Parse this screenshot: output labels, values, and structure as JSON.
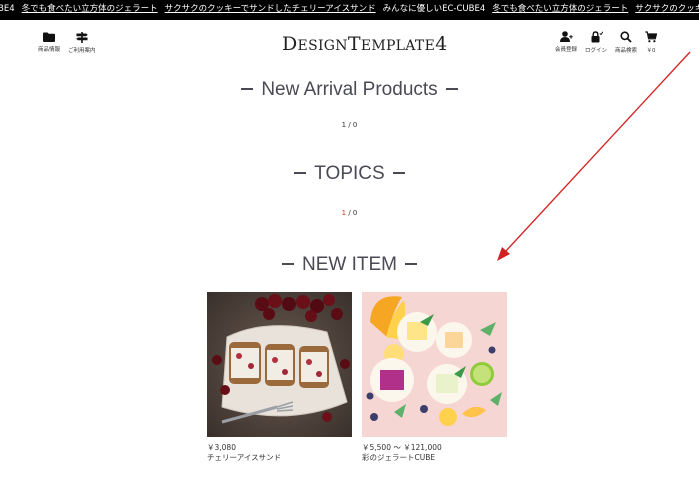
{
  "ticker": {
    "items": [
      {
        "text": "BE4",
        "link": false
      },
      {
        "text": "冬でも食べたい立方体のジェラート",
        "link": true
      },
      {
        "text": "サクサクのクッキーでサンドしたチェリーアイスサンド",
        "link": true
      },
      {
        "text": "みんなに優しいEC-CUBE4",
        "link": false
      },
      {
        "text": "冬でも食べたい立方体のジェラート",
        "link": true
      },
      {
        "text": "サクサクのクッキーでサンドしたチェリーアイスサ",
        "link": true
      }
    ]
  },
  "header": {
    "left": [
      {
        "label": "商品情報",
        "icon": "folder-icon"
      },
      {
        "label": "ご利用案内",
        "icon": "signpost-icon"
      }
    ],
    "logo": {
      "d": "D",
      "esign": "ESIGN",
      "t": "T",
      "emplate": "EMPLATE",
      "num": "4"
    },
    "right": [
      {
        "label": "会員登録",
        "icon": "user-add-icon"
      },
      {
        "label": "ログイン",
        "icon": "lock-icon"
      },
      {
        "label": "商品検索",
        "icon": "search-icon"
      },
      {
        "label": "￥0",
        "icon": "cart-icon"
      }
    ]
  },
  "sections": {
    "new_arrival": {
      "title": "New Arrival Products",
      "pager_cur": "1",
      "pager_rest": " / 0"
    },
    "topics": {
      "title": "TOPICS",
      "pager_cur": "1",
      "pager_rest": " / 0"
    },
    "new_item": {
      "title": "NEW ITEM"
    }
  },
  "products": [
    {
      "price": "￥3,080",
      "name": "チェリーアイスサンド"
    },
    {
      "price": "￥5,500 ～ ￥121,000",
      "name": "彩のジェラートCUBE"
    }
  ],
  "colors": {
    "accent_red": "#e0301e",
    "ticker_bg": "#000000",
    "title": "#4a4a55"
  }
}
